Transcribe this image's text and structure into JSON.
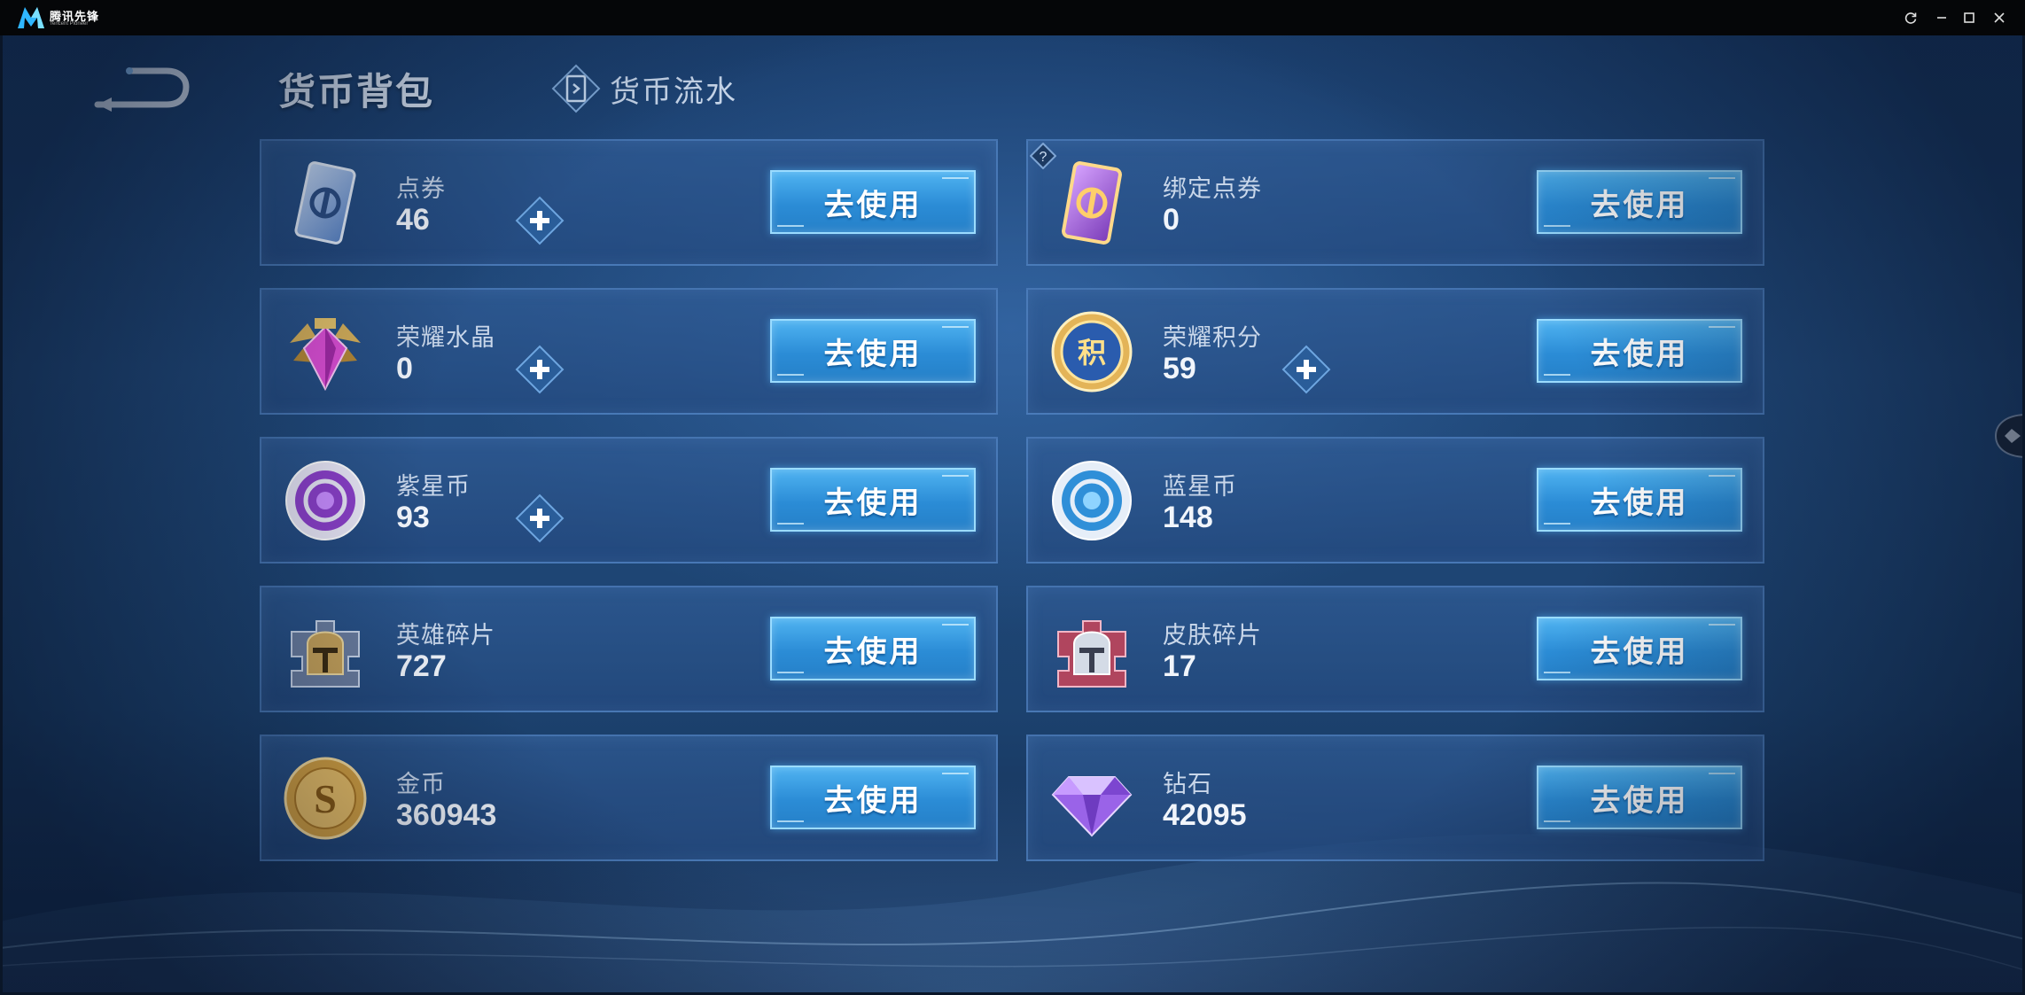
{
  "window": {
    "brand": "腾讯先锋",
    "brand_sub": "Tencent Pioneer",
    "controls": [
      "refresh-icon",
      "minimize-icon",
      "maximize-icon",
      "close-icon"
    ]
  },
  "header": {
    "active_tab": "货币背包",
    "other_tab": "货币流水"
  },
  "colors": {
    "accent_button": "#2b8cd6",
    "card_border": "#60a0d8",
    "background": "#1f4676"
  },
  "currencies": [
    {
      "name": "点券",
      "amount": "46",
      "icon": "voucher-card-icon",
      "has_plus": true,
      "button": "去使用"
    },
    {
      "name": "绑定点券",
      "amount": "0",
      "icon": "bound-voucher-card-icon",
      "has_plus": false,
      "has_help": true,
      "button": "去使用"
    },
    {
      "name": "荣耀水晶",
      "amount": "0",
      "icon": "glory-crystal-icon",
      "has_plus": true,
      "button": "去使用"
    },
    {
      "name": "荣耀积分",
      "amount": "59",
      "icon": "glory-points-icon",
      "has_plus": true,
      "button": "去使用"
    },
    {
      "name": "紫星币",
      "amount": "93",
      "icon": "purple-star-coin-icon",
      "has_plus": true,
      "button": "去使用"
    },
    {
      "name": "蓝星币",
      "amount": "148",
      "icon": "blue-star-coin-icon",
      "has_plus": false,
      "button": "去使用"
    },
    {
      "name": "英雄碎片",
      "amount": "727",
      "icon": "hero-fragment-icon",
      "has_plus": false,
      "button": "去使用"
    },
    {
      "name": "皮肤碎片",
      "amount": "17",
      "icon": "skin-fragment-icon",
      "has_plus": false,
      "button": "去使用"
    },
    {
      "name": "金币",
      "amount": "360943",
      "icon": "gold-coin-icon",
      "has_plus": false,
      "button": "去使用"
    },
    {
      "name": "钻石",
      "amount": "42095",
      "icon": "diamond-icon",
      "has_plus": false,
      "button": "去使用"
    }
  ]
}
